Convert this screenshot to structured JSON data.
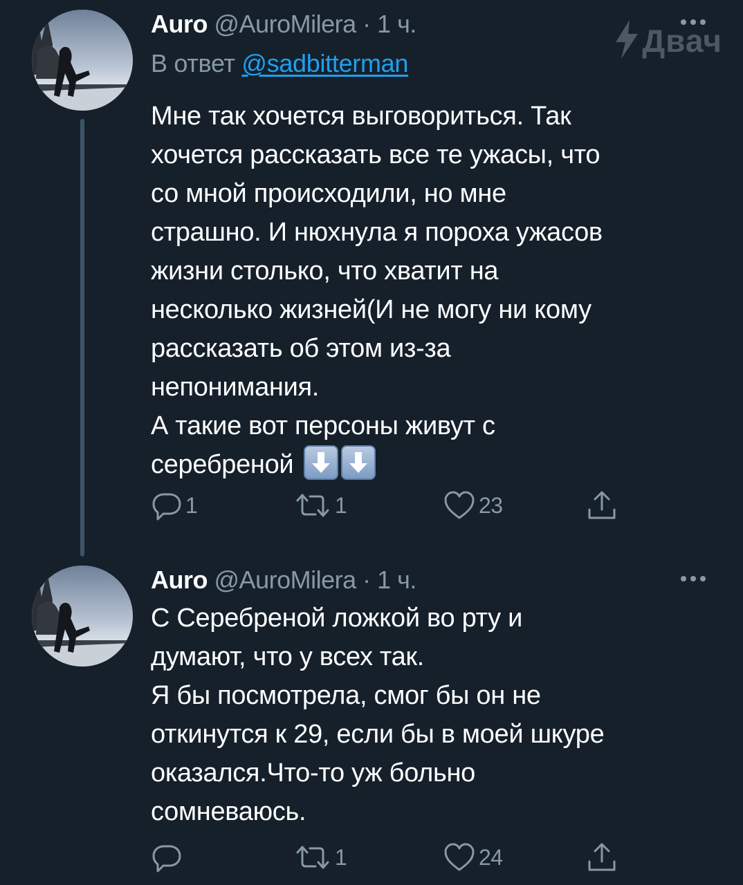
{
  "watermark": {
    "text": "Двач",
    "icon": "lightning-icon"
  },
  "colors": {
    "background": "#15202b",
    "text": "#ffffff",
    "secondary": "#8899a6",
    "link": "#1da1f2",
    "thread_line": "#3d5466"
  },
  "tweets": [
    {
      "name": "Auro",
      "handle": "@AuroMilera",
      "separator": "·",
      "time": "1 ч.",
      "reply_prefix": "В ответ",
      "reply_mention": "@sadbitterman",
      "lines": [
        "Мне так хочется выговориться. Так",
        "хочется рассказать все те ужасы, что",
        "со мной происходили, но мне",
        "страшно. И нюхнула я пороха ужасов",
        "жизни столько, что хватит на",
        "несколько жизней(И не могу ни кому",
        "рассказать об этом из-за",
        "непонимания.",
        "А такие вот персоны живут с",
        "серебреной"
      ],
      "emoji": [
        "down-arrow-emoji",
        "down-arrow-emoji"
      ],
      "stats": {
        "replies": "1",
        "retweets": "1",
        "likes": "23"
      }
    },
    {
      "name": "Auro",
      "handle": "@AuroMilera",
      "separator": "·",
      "time": "1 ч.",
      "lines": [
        "С Серебреной ложкой во рту и",
        "думают, что у всех так.",
        "Я бы посмотрела, смог бы он не",
        "откинутся к 29, если бы в моей шкуре",
        "оказался.Что-то уж больно",
        "сомневаюсь."
      ],
      "stats": {
        "replies": "",
        "retweets": "1",
        "likes": "24"
      }
    }
  ]
}
